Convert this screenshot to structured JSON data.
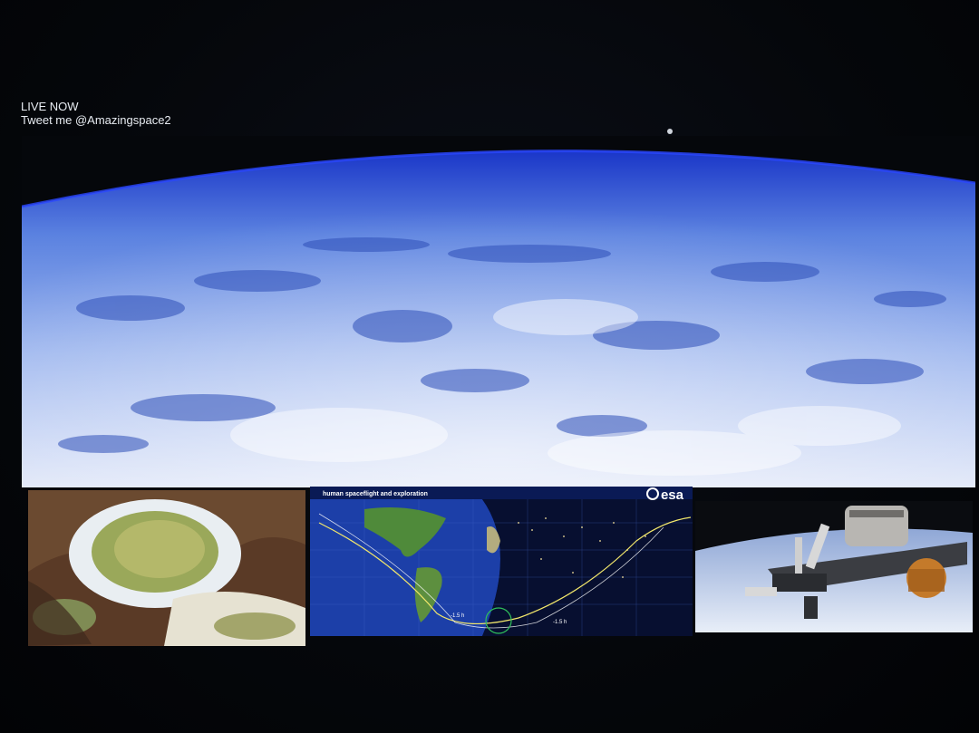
{
  "overlay": {
    "live_label": "LIVE NOW",
    "tweet_label": "Tweet me @Amazingspace2"
  },
  "main_feed": {
    "description_icon": "earth-horizon-view"
  },
  "map_panel": {
    "title": "human spaceflight and exploration",
    "logo_text": "esa",
    "time_marks": [
      "-1.5 h",
      "-1.5 h"
    ]
  },
  "colors": {
    "background": "#04060a",
    "earth_blue": "#3f66d8",
    "cloud_white": "#dfe8fb",
    "map_ocean": "#1c3fa8",
    "orbit_yellow": "#f2e76b"
  }
}
